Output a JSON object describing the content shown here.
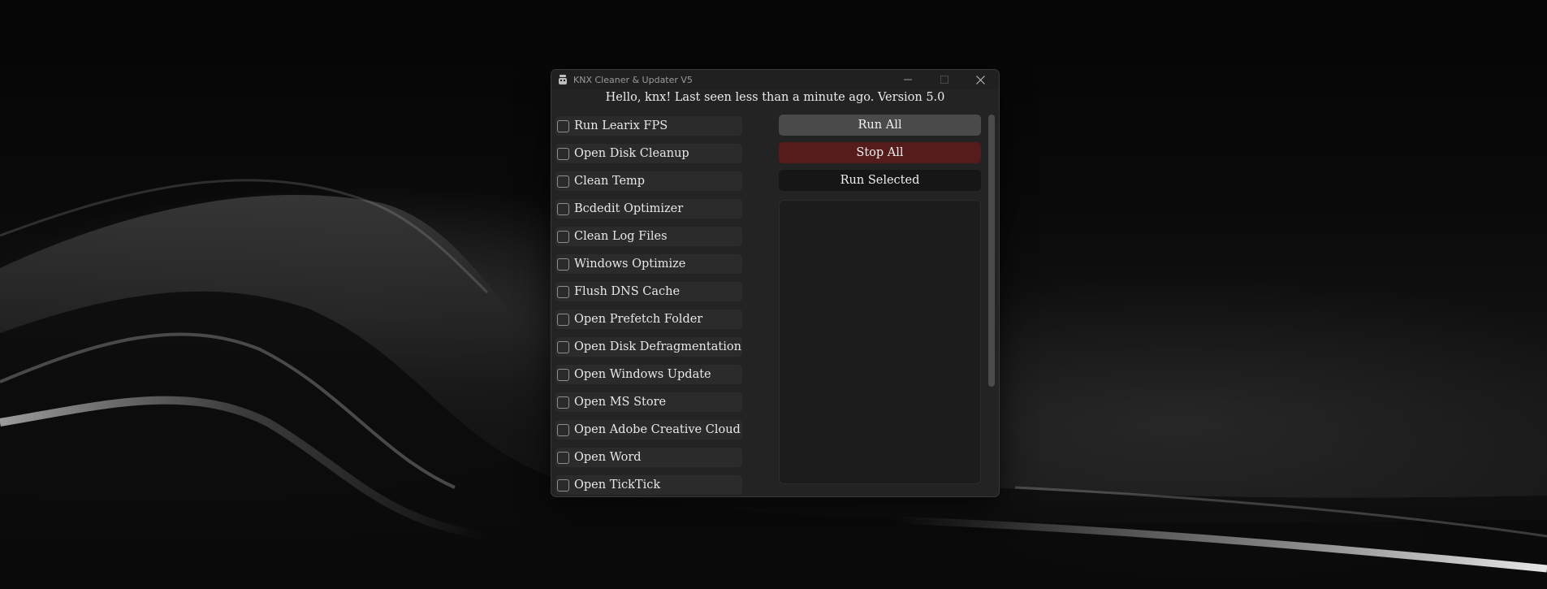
{
  "window": {
    "title": "KNX Cleaner & Updater V5"
  },
  "greeting": "Hello, knx! Last seen less than a minute ago. Version 5.0",
  "tasks": [
    {
      "label": "Run Learix FPS",
      "checked": false
    },
    {
      "label": "Open Disk Cleanup",
      "checked": false
    },
    {
      "label": "Clean Temp",
      "checked": false
    },
    {
      "label": "Bcdedit Optimizer",
      "checked": false
    },
    {
      "label": "Clean Log Files",
      "checked": false
    },
    {
      "label": "Windows Optimize",
      "checked": false
    },
    {
      "label": "Flush DNS Cache",
      "checked": false
    },
    {
      "label": "Open Prefetch Folder",
      "checked": false
    },
    {
      "label": "Open Disk Defragmentation",
      "checked": false
    },
    {
      "label": "Open Windows Update",
      "checked": false
    },
    {
      "label": "Open MS Store",
      "checked": false
    },
    {
      "label": "Open Adobe Creative Cloud",
      "checked": false
    },
    {
      "label": "Open Word",
      "checked": false
    },
    {
      "label": "Open TickTick",
      "checked": false
    }
  ],
  "buttons": {
    "run_all": "Run All",
    "stop_all": "Stop All",
    "run_selected": "Run Selected"
  },
  "output": {
    "text": ""
  },
  "colors": {
    "window_bg": "#232323",
    "run_all": "#4a4a4a",
    "stop_all": "#561c1c",
    "run_selected": "#161616"
  },
  "icons": {
    "app": "app-icon",
    "minimize": "minimize-icon",
    "maximize": "maximize-icon",
    "close": "close-icon"
  }
}
